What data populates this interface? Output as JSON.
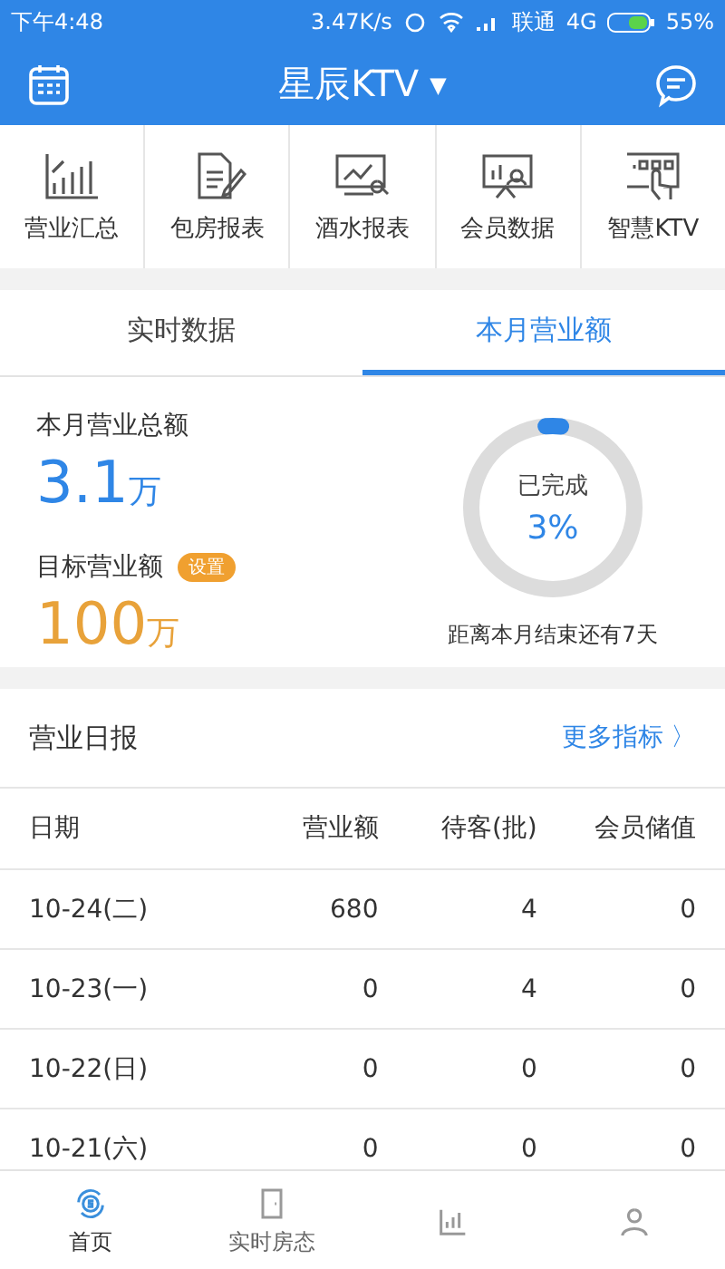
{
  "status_bar": {
    "time": "下午4:48",
    "speed": "3.47K/s",
    "carrier": "联通",
    "network": "4G",
    "battery": "55%"
  },
  "header": {
    "title": "星辰KTV",
    "dropdown": "▼"
  },
  "shortcuts": [
    {
      "label": "营业汇总",
      "kind": "chart"
    },
    {
      "label": "包房报表",
      "kind": "doc"
    },
    {
      "label": "酒水报表",
      "kind": "monitor"
    },
    {
      "label": "会员数据",
      "kind": "member"
    },
    {
      "label": "智慧KTV",
      "kind": "touch"
    }
  ],
  "tabs": [
    {
      "label": "实时数据",
      "selected": false
    },
    {
      "label": "本月营业额",
      "selected": true
    }
  ],
  "summary": {
    "total_label": "本月营业总额",
    "total_value": "3.1",
    "total_unit": "万",
    "target_label": "目标营业额",
    "target_badge": "设置",
    "target_value": "100",
    "target_unit": "万",
    "ring_label": "已完成",
    "ring_percent": "3%",
    "days_left": "距离本月结束还有7天"
  },
  "daily": {
    "title": "营业日报",
    "more": "更多指标",
    "more_icon": "〉",
    "columns": [
      "日期",
      "营业额",
      "待客(批)",
      "会员储值"
    ],
    "rows": [
      [
        "10-24(二)",
        "680",
        "4",
        "0"
      ],
      [
        "10-23(一)",
        "0",
        "4",
        "0"
      ],
      [
        "10-22(日)",
        "0",
        "0",
        "0"
      ],
      [
        "10-21(六)",
        "0",
        "0",
        "0"
      ]
    ]
  },
  "bottom_tabs": [
    {
      "label": "首页",
      "selected": true,
      "kind": "home"
    },
    {
      "label": "实时房态",
      "selected": false,
      "kind": "rooms"
    },
    {
      "selected": false,
      "kind": "report"
    },
    {
      "selected": false,
      "kind": "me"
    }
  ]
}
